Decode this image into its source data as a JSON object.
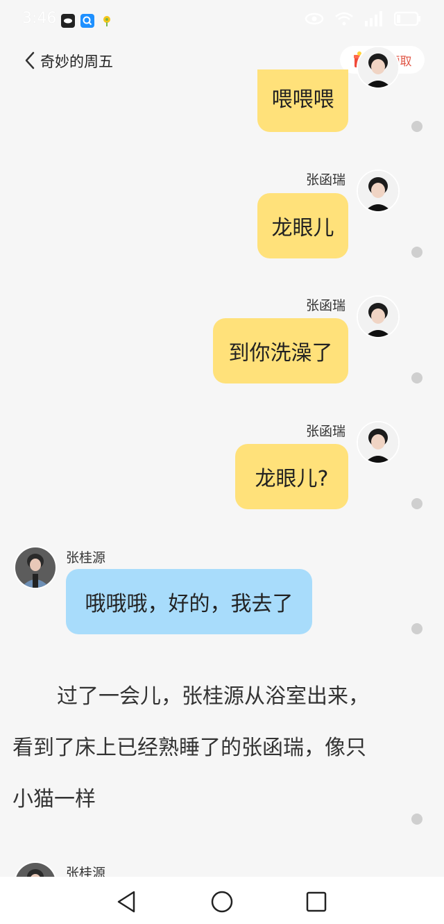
{
  "status_bar": {
    "time": "3:46"
  },
  "header": {
    "title": "奇妙的周五",
    "claim_label": "可领取"
  },
  "messages": [
    {
      "sender": "",
      "text": "喂喂喂",
      "side": "right"
    },
    {
      "sender": "张函瑞",
      "text": "龙眼儿",
      "side": "right"
    },
    {
      "sender": "张函瑞",
      "text": "到你洗澡了",
      "side": "right"
    },
    {
      "sender": "张函瑞",
      "text": "龙眼儿?",
      "side": "right"
    },
    {
      "sender": "张桂源",
      "text": "哦哦哦，好的，我去了",
      "side": "left"
    }
  ],
  "narration": {
    "line1": "过了一会儿，张桂源从浴室出来，",
    "line2": "看到了床上已经熟睡了的张函瑞，像只",
    "line3": "小猫一样"
  },
  "next_sender": "张桂源",
  "colors": {
    "right_bubble": "#ffe17a",
    "left_bubble": "#a8dcfb",
    "background": "#f6f6f6",
    "claim_text": "#e05545"
  }
}
